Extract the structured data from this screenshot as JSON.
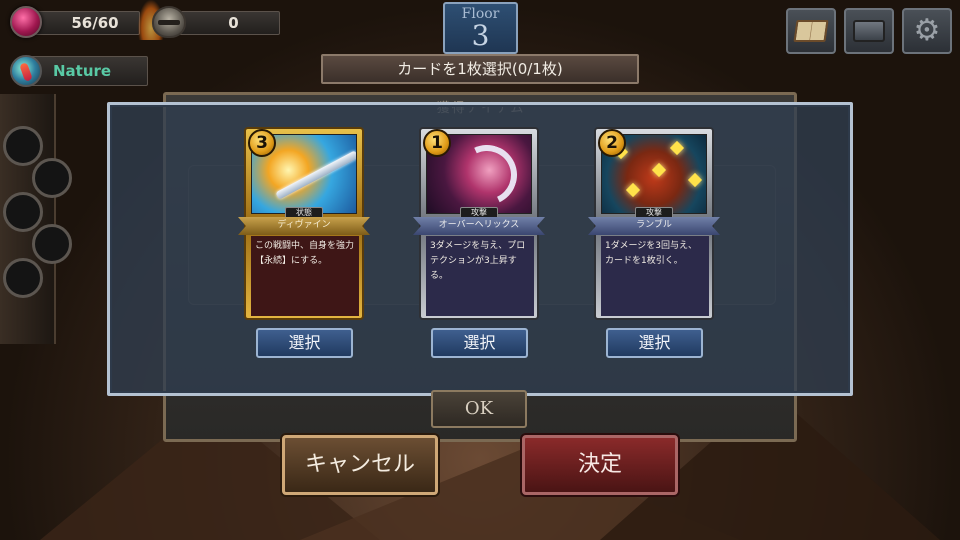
{
  "hud": {
    "hp": "56/60",
    "gold": "0",
    "element": "Nature",
    "element_color": "#59c9a5"
  },
  "floor": {
    "label": "Floor",
    "number": "3"
  },
  "top_buttons": [
    {
      "icon": "book-icon"
    },
    {
      "icon": "chest-icon"
    },
    {
      "icon": "gear-icon"
    }
  ],
  "banner": {
    "text": "カードを1枚選択(0/1枚)"
  },
  "underlying_dialog": {
    "title": "獲得アイテム",
    "ok_label": "OK"
  },
  "cards": [
    {
      "cost": "3",
      "type": "状態",
      "name": "ディヴァイン",
      "description": "この戦闘中、自身を強力【永続】にする。",
      "frame": "gold",
      "select_label": "選択"
    },
    {
      "cost": "1",
      "type": "攻撃",
      "name": "オーバーヘリックス",
      "description": "3ダメージを与え、プロテクションが3上昇する。",
      "frame": "silver",
      "select_label": "選択"
    },
    {
      "cost": "2",
      "type": "攻撃",
      "name": "ランブル",
      "description": "1ダメージを3回与え、カードを1枚引く。",
      "frame": "silver",
      "select_label": "選択"
    }
  ],
  "actions": {
    "cancel_label": "キャンセル",
    "confirm_label": "決定"
  }
}
